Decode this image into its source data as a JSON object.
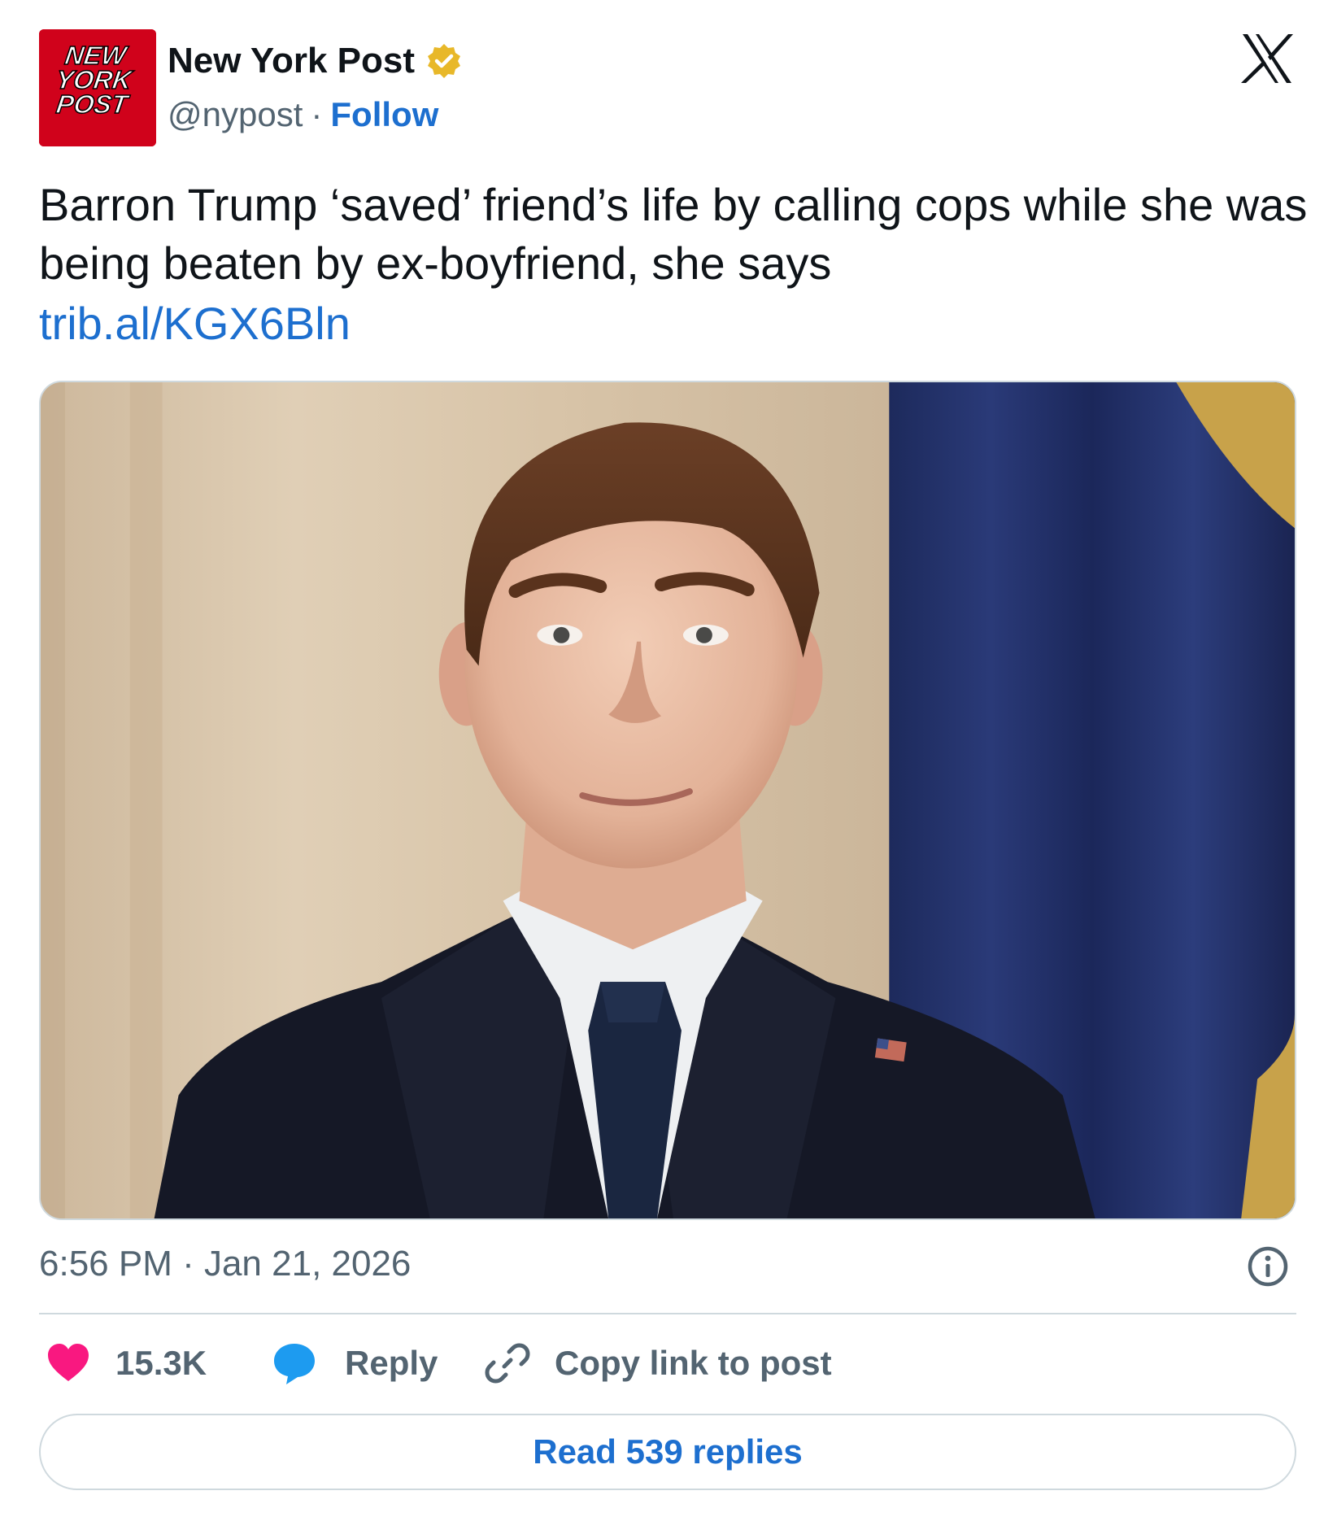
{
  "author": {
    "name": "New York Post",
    "handle": "@nypost",
    "separator": "·",
    "follow_label": "Follow",
    "verified": true,
    "avatar_text": [
      "NEW",
      "YORK",
      "POST"
    ],
    "avatar_color": "#d0021b",
    "verified_color": "#e8b829"
  },
  "post": {
    "text": "Barron Trump ‘saved’ friend’s life by calling cops while she was being beaten by ex-boyfriend, she says",
    "link": "trib.al/KGX6Bln",
    "timestamp": "6:56 PM · Jan 21, 2026"
  },
  "actions": {
    "like_count": "15.3K",
    "reply_label": "Reply",
    "copy_label": "Copy link to post",
    "read_replies_label": "Read 539 replies"
  },
  "icons": {
    "platform": "x-logo-icon",
    "verified": "verified-badge-icon",
    "info": "info-icon",
    "like": "heart-icon",
    "reply": "speech-bubble-icon",
    "copy": "link-icon"
  },
  "colors": {
    "link": "#1d6fcf",
    "heart": "#f91880",
    "reply": "#1d9bf0",
    "secondary_text": "#536471"
  }
}
